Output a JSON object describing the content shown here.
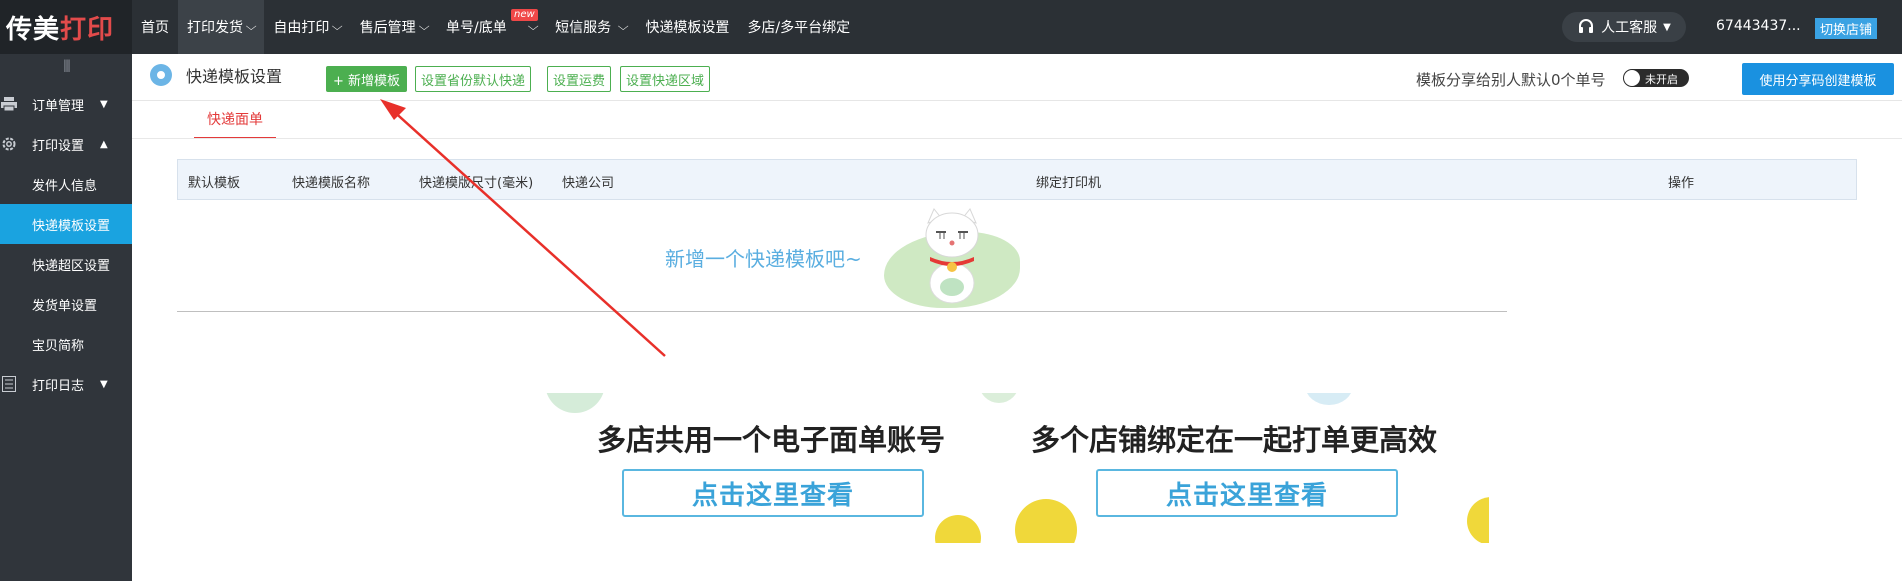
{
  "topbar": {
    "logo_main": "传美",
    "logo_rest": "打印",
    "nav": [
      {
        "label": "首页",
        "caret": false
      },
      {
        "label": "打印发货",
        "caret": true
      },
      {
        "label": "自由打印",
        "caret": true
      },
      {
        "label": "售后管理",
        "caret": true
      },
      {
        "label": "单号/底单",
        "caret": true,
        "badge": "new"
      },
      {
        "label": "短信服务",
        "caret": true
      },
      {
        "label": "快递模板设置",
        "caret": false
      },
      {
        "label": "多店/多平台绑定",
        "caret": false
      }
    ],
    "service_label": "人工客服",
    "account": "67443437...",
    "switch_shop": "切换店铺"
  },
  "sidebar": {
    "grip": "|||",
    "groups": [
      {
        "label": "订单管理",
        "icon": "printer-icon",
        "expanded": false
      },
      {
        "label": "打印设置",
        "icon": "gear-icon",
        "expanded": true
      },
      {
        "label": "打印日志",
        "icon": "list-icon",
        "expanded": false
      }
    ],
    "sub_items": [
      "发件人信息",
      "快递模板设置",
      "快递超区设置",
      "发货单设置",
      "宝贝简称"
    ],
    "active_sub": "快递模板设置"
  },
  "header": {
    "title": "快递模板设置",
    "add_template": "+ 新增模板",
    "btn_province_default": "设置省份默认快递",
    "btn_freight": "设置运费",
    "btn_area": "设置快递区域",
    "share_text": "模板分享给别人默认0个单号",
    "toggle_label": "未开启",
    "create_by_code": "使用分享码创建模板"
  },
  "tabs": [
    "快递面单"
  ],
  "table": {
    "columns": [
      "默认模板",
      "快递模版名称",
      "快递模版尺寸(毫米)",
      "快递公司",
      "绑定打印机",
      "操作"
    ]
  },
  "empty_state": {
    "text": "新增一个快递模板吧~"
  },
  "promo": {
    "left_title": "多店共用一个电子面单账号",
    "right_title": "多个店铺绑定在一起打单更高效",
    "left_button": "点击这里查看",
    "right_button": "点击这里查看"
  },
  "colors": {
    "topbar_bg": "#2b3035",
    "sidebar_bg": "#30353b",
    "active_blue": "#1aa3e0",
    "green": "#4caf50",
    "tab_red": "#e33a3a",
    "annotation_arrow": "#e8302a"
  }
}
